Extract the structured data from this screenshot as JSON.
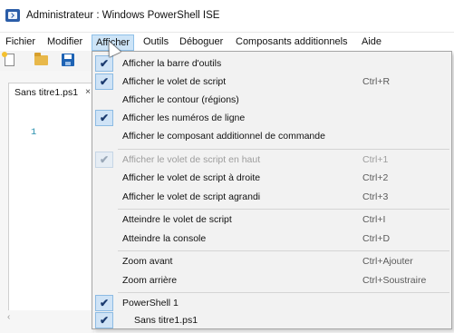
{
  "window": {
    "title": "Administrateur : Windows PowerShell ISE"
  },
  "menubar": {
    "items": [
      "Fichier",
      "Modifier",
      "Afficher",
      "Outils",
      "Déboguer",
      "Composants additionnels",
      "Aide"
    ],
    "active": "Afficher"
  },
  "toolbar": {
    "icons": [
      "new-file-icon",
      "open-folder-icon",
      "save-icon"
    ]
  },
  "editor": {
    "tab_label": "Sans titre1.ps1",
    "tab_close": "×",
    "line_number": "1",
    "scroll_left": "‹"
  },
  "dropdown": {
    "items": [
      {
        "label": "Afficher la barre d'outils",
        "checked": true,
        "shortcut": ""
      },
      {
        "label": "Afficher le volet de script",
        "checked": true,
        "shortcut": "Ctrl+R"
      },
      {
        "label": "Afficher le contour (régions)",
        "checked": false,
        "shortcut": ""
      },
      {
        "label": "Afficher les numéros de ligne",
        "checked": true,
        "shortcut": ""
      },
      {
        "label": "Afficher le composant additionnel de commande",
        "checked": false,
        "shortcut": ""
      },
      {
        "label": "Afficher le volet de script en haut",
        "checked": true,
        "disabled": true,
        "shortcut": "Ctrl+1"
      },
      {
        "label": "Afficher le volet de script à droite",
        "checked": false,
        "shortcut": "Ctrl+2"
      },
      {
        "label": "Afficher le volet de script agrandi",
        "checked": false,
        "shortcut": "Ctrl+3"
      },
      {
        "label": "Atteindre le volet de script",
        "checked": false,
        "shortcut": "Ctrl+I"
      },
      {
        "label": "Atteindre la console",
        "checked": false,
        "shortcut": "Ctrl+D"
      },
      {
        "label": "Zoom avant",
        "checked": false,
        "shortcut": "Ctrl+Ajouter"
      },
      {
        "label": "Zoom arrière",
        "checked": false,
        "shortcut": "Ctrl+Soustraire"
      },
      {
        "label": "PowerShell 1",
        "checked": true,
        "shortcut": ""
      },
      {
        "label": "    Sans titre1.ps1",
        "checked": true,
        "shortcut": ""
      }
    ],
    "check_glyph": "✔"
  },
  "colors": {
    "menu_highlight": "#cde4f7",
    "check_bg": "#cfe3f6",
    "line_number": "#2b91af"
  }
}
